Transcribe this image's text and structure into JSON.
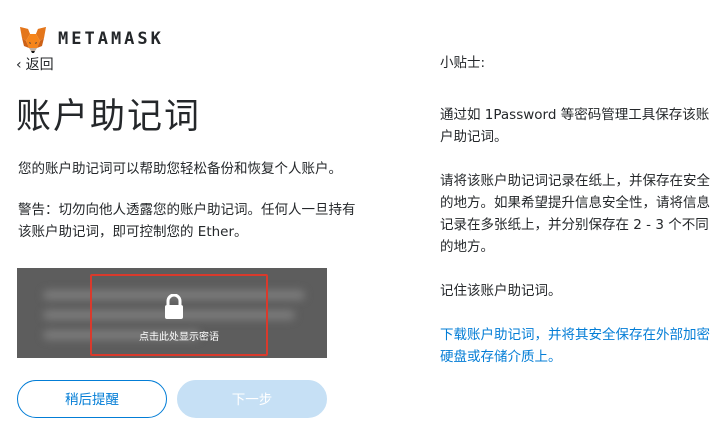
{
  "header": {
    "brand": "METAMASK"
  },
  "nav": {
    "back_label": "返回"
  },
  "main": {
    "title": "账户助记词",
    "description": "您的账户助记词可以帮助您轻松备份和恢复个人账户。",
    "warning": "警告：切勿向他人透露您的账户助记词。任何人一旦持有该账户助记词，即可控制您的 Ether。",
    "secret": {
      "reveal_label": "点击此处显示密语"
    }
  },
  "buttons": {
    "remind_later": "稍后提醒",
    "next": "下一步"
  },
  "tips": {
    "title": "小贴士:",
    "tip1": "通过如 1Password 等密码管理工具保存该账户助记词。",
    "tip2": "请将该账户助记词记录在纸上，并保存在安全的地方。如果希望提升信息安全性，请将信息记录在多张纸上，并分别保存在 2 - 3 个不同的地方。",
    "tip3": "记住该账户助记词。",
    "download_link": "下载账户助记词，并将其安全保存在外部加密硬盘或存储介质上。"
  },
  "colors": {
    "accent": "#037dd6",
    "disabled": "#c6e0f5",
    "highlight_border": "#d93a2c",
    "secret_bg": "#5d5d5d"
  },
  "icons": [
    "metamask-fox-icon",
    "chevron-left-icon",
    "lock-icon"
  ]
}
